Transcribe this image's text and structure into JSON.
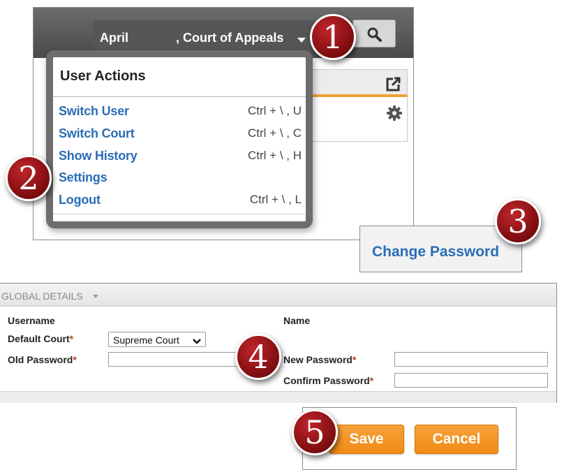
{
  "header": {
    "user_first": "April",
    "user_court": ", Court of Appeals"
  },
  "user_actions_menu": {
    "title": "User Actions",
    "items": [
      {
        "label": "Switch User",
        "shortcut": "Ctrl + \\ , U"
      },
      {
        "label": "Switch Court",
        "shortcut": "Ctrl + \\ , C"
      },
      {
        "label": "Show History",
        "shortcut": "Ctrl + \\ , H"
      },
      {
        "label": "Settings",
        "shortcut": ""
      },
      {
        "label": "Logout",
        "shortcut": "Ctrl + \\ , L"
      }
    ]
  },
  "settings_panel": {
    "change_password_link": "Change Password"
  },
  "global_details": {
    "title": "GLOBAL DETAILS",
    "username_label": "Username",
    "name_label": "Name",
    "default_court_label": "Default Court",
    "default_court_value": "Supreme Court",
    "old_password_label": "Old Password",
    "new_password_label": "New Password",
    "confirm_password_label": "Confirm Password",
    "required_marker": "*"
  },
  "actions": {
    "save_label": "Save",
    "cancel_label": "Cancel"
  },
  "step_badges": [
    "1",
    "2",
    "3",
    "4",
    "5"
  ],
  "colors": {
    "header_bg": "#4a4a4a",
    "link_blue": "#2a6db5",
    "accent_orange": "#f08a14",
    "badge_red": "#8b1115",
    "required_red": "#c0392b"
  },
  "icons": [
    "search-icon",
    "chevron-down-icon",
    "export-icon",
    "gear-icon"
  ]
}
